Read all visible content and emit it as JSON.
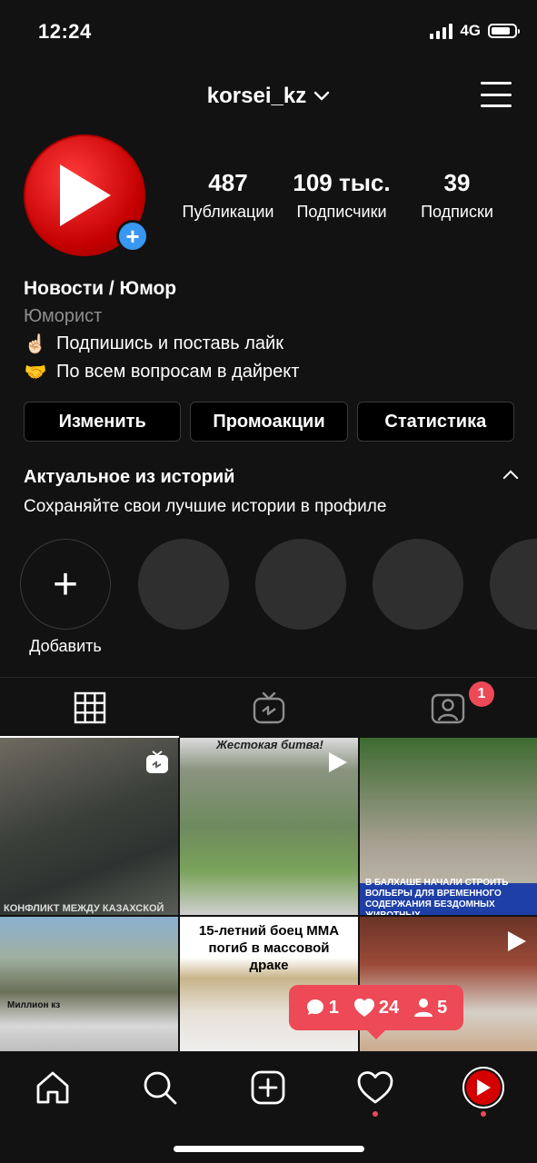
{
  "status_bar": {
    "time": "12:24",
    "network": "4G",
    "battery_level": 0.85,
    "signal_bars": 4
  },
  "header": {
    "username": "korsei_kz"
  },
  "profile": {
    "stats": [
      {
        "value": "487",
        "label": "Публикации"
      },
      {
        "value": "109 тыс.",
        "label": "Подписчики"
      },
      {
        "value": "39",
        "label": "Подписки"
      }
    ],
    "name": "Новости / Юмор",
    "category": "Юморист",
    "bio_lines": [
      {
        "emoji": "☝🏻",
        "text": "Подпишись и поставь лайк"
      },
      {
        "emoji": "🤝",
        "text": "По всем вопросам в дайрект"
      }
    ]
  },
  "buttons": {
    "edit": "Изменить",
    "promo": "Промоакции",
    "stats": "Статистика"
  },
  "highlights": {
    "title": "Актуальное из историй",
    "subtitle": "Сохраняйте свои лучшие истории в профиле",
    "add_label": "Добавить"
  },
  "tabs": {
    "tagged_notifications": "1"
  },
  "grid_posts": [
    {
      "caption": "КОНФЛИКТ МЕЖДУ КАЗАХСКОЙ",
      "type": "igtv"
    },
    {
      "caption": "Жестокая битва!",
      "type": "video"
    },
    {
      "caption": "В БАЛХАШЕ НАЧАЛИ СТРОИТЬ ВОЛЬЕРЫ ДЛЯ ВРЕМЕННОГО СОДЕРЖАНИЯ БЕЗДОМНЫХ ЖИВОТНЫХ",
      "type": "image"
    },
    {
      "caption": "Миллион кз",
      "type": "image"
    },
    {
      "caption": "15-летний боец ММА погиб в массовой драке",
      "type": "image"
    },
    {
      "caption": "",
      "type": "video"
    }
  ],
  "activity": {
    "comments": "1",
    "likes": "24",
    "follows": "5"
  },
  "colors": {
    "background": "#121212",
    "accent_blue": "#3897f0",
    "notification_red": "#ed4956",
    "brand_red": "#d40000"
  }
}
